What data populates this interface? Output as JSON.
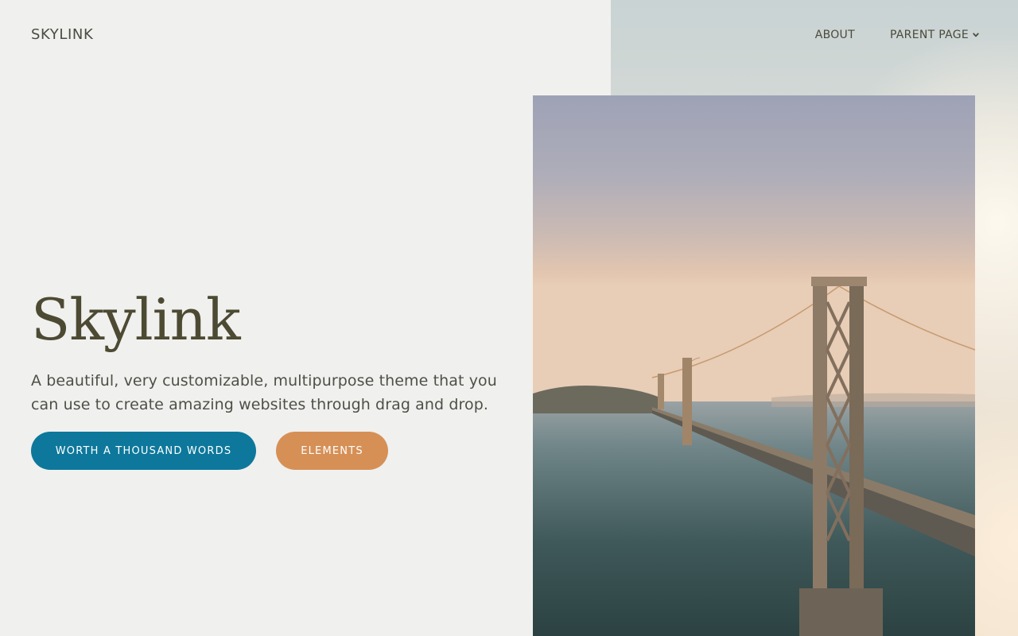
{
  "header": {
    "logo": "SKYLINK",
    "nav": [
      {
        "label": "ABOUT"
      },
      {
        "label": "PARENT PAGE",
        "icon": "chevron-down-icon"
      }
    ]
  },
  "hero": {
    "title": "Skylink",
    "description": "A beautiful, very customizable, multipurpose theme that you can use to create amazing websites through drag and drop.",
    "primary_button": "WORTH A THOUSAND WORDS",
    "secondary_button": "ELEMENTS"
  },
  "colors": {
    "background": "#f0f0ee",
    "primary_button": "#0d789b",
    "secondary_button": "#d69056",
    "title": "#4d4a33"
  }
}
